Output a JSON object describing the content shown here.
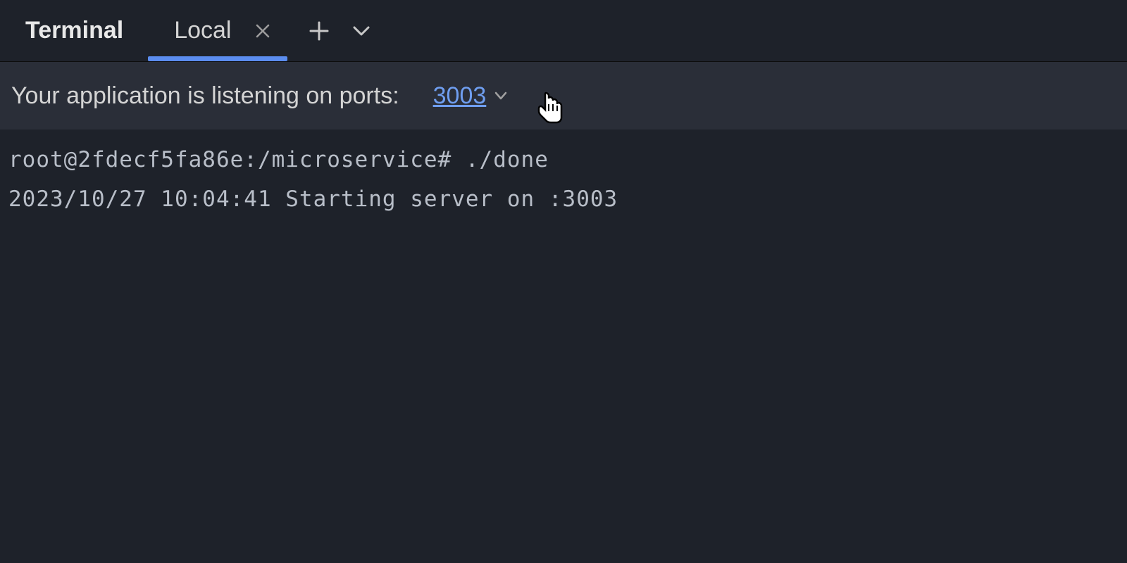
{
  "tabs": {
    "terminal_label": "Terminal",
    "local_label": "Local"
  },
  "ports_bar": {
    "message": "Your application is listening on ports:",
    "port": "3003"
  },
  "terminal": {
    "lines": [
      "root@2fdecf5fa86e:/microservice# ./done",
      "2023/10/27 10:04:41 Starting server on :3003"
    ]
  }
}
